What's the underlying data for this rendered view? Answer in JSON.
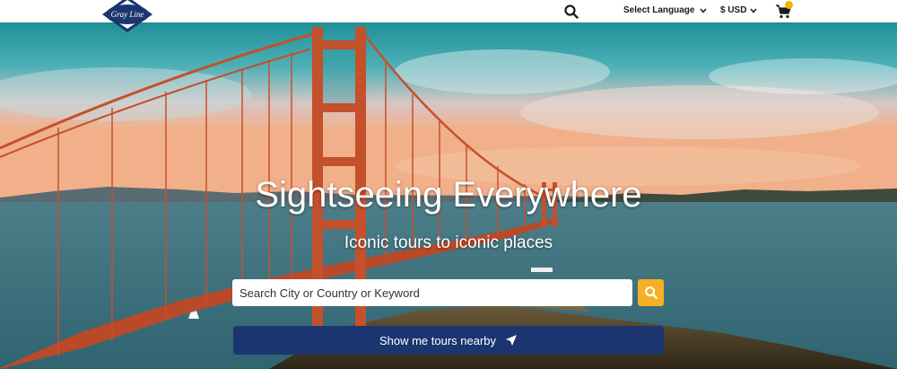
{
  "header": {
    "logo_text": "Gray Line",
    "language_label": "Select Language",
    "currency_label": "$ USD",
    "cart_count": ""
  },
  "hero": {
    "title": "Sightseeing Everywhere",
    "subtitle": "Iconic tours to iconic places",
    "search_placeholder": "Search City or Country or Keyword",
    "nearby_button_label": "Show me tours nearby"
  },
  "colors": {
    "brand_navy": "#1b3570",
    "accent_yellow": "#f5b024",
    "bridge_orange": "#c4502c"
  },
  "icons": [
    "search-icon",
    "chevron-down-icon",
    "cart-icon",
    "navigation-arrow-icon"
  ]
}
